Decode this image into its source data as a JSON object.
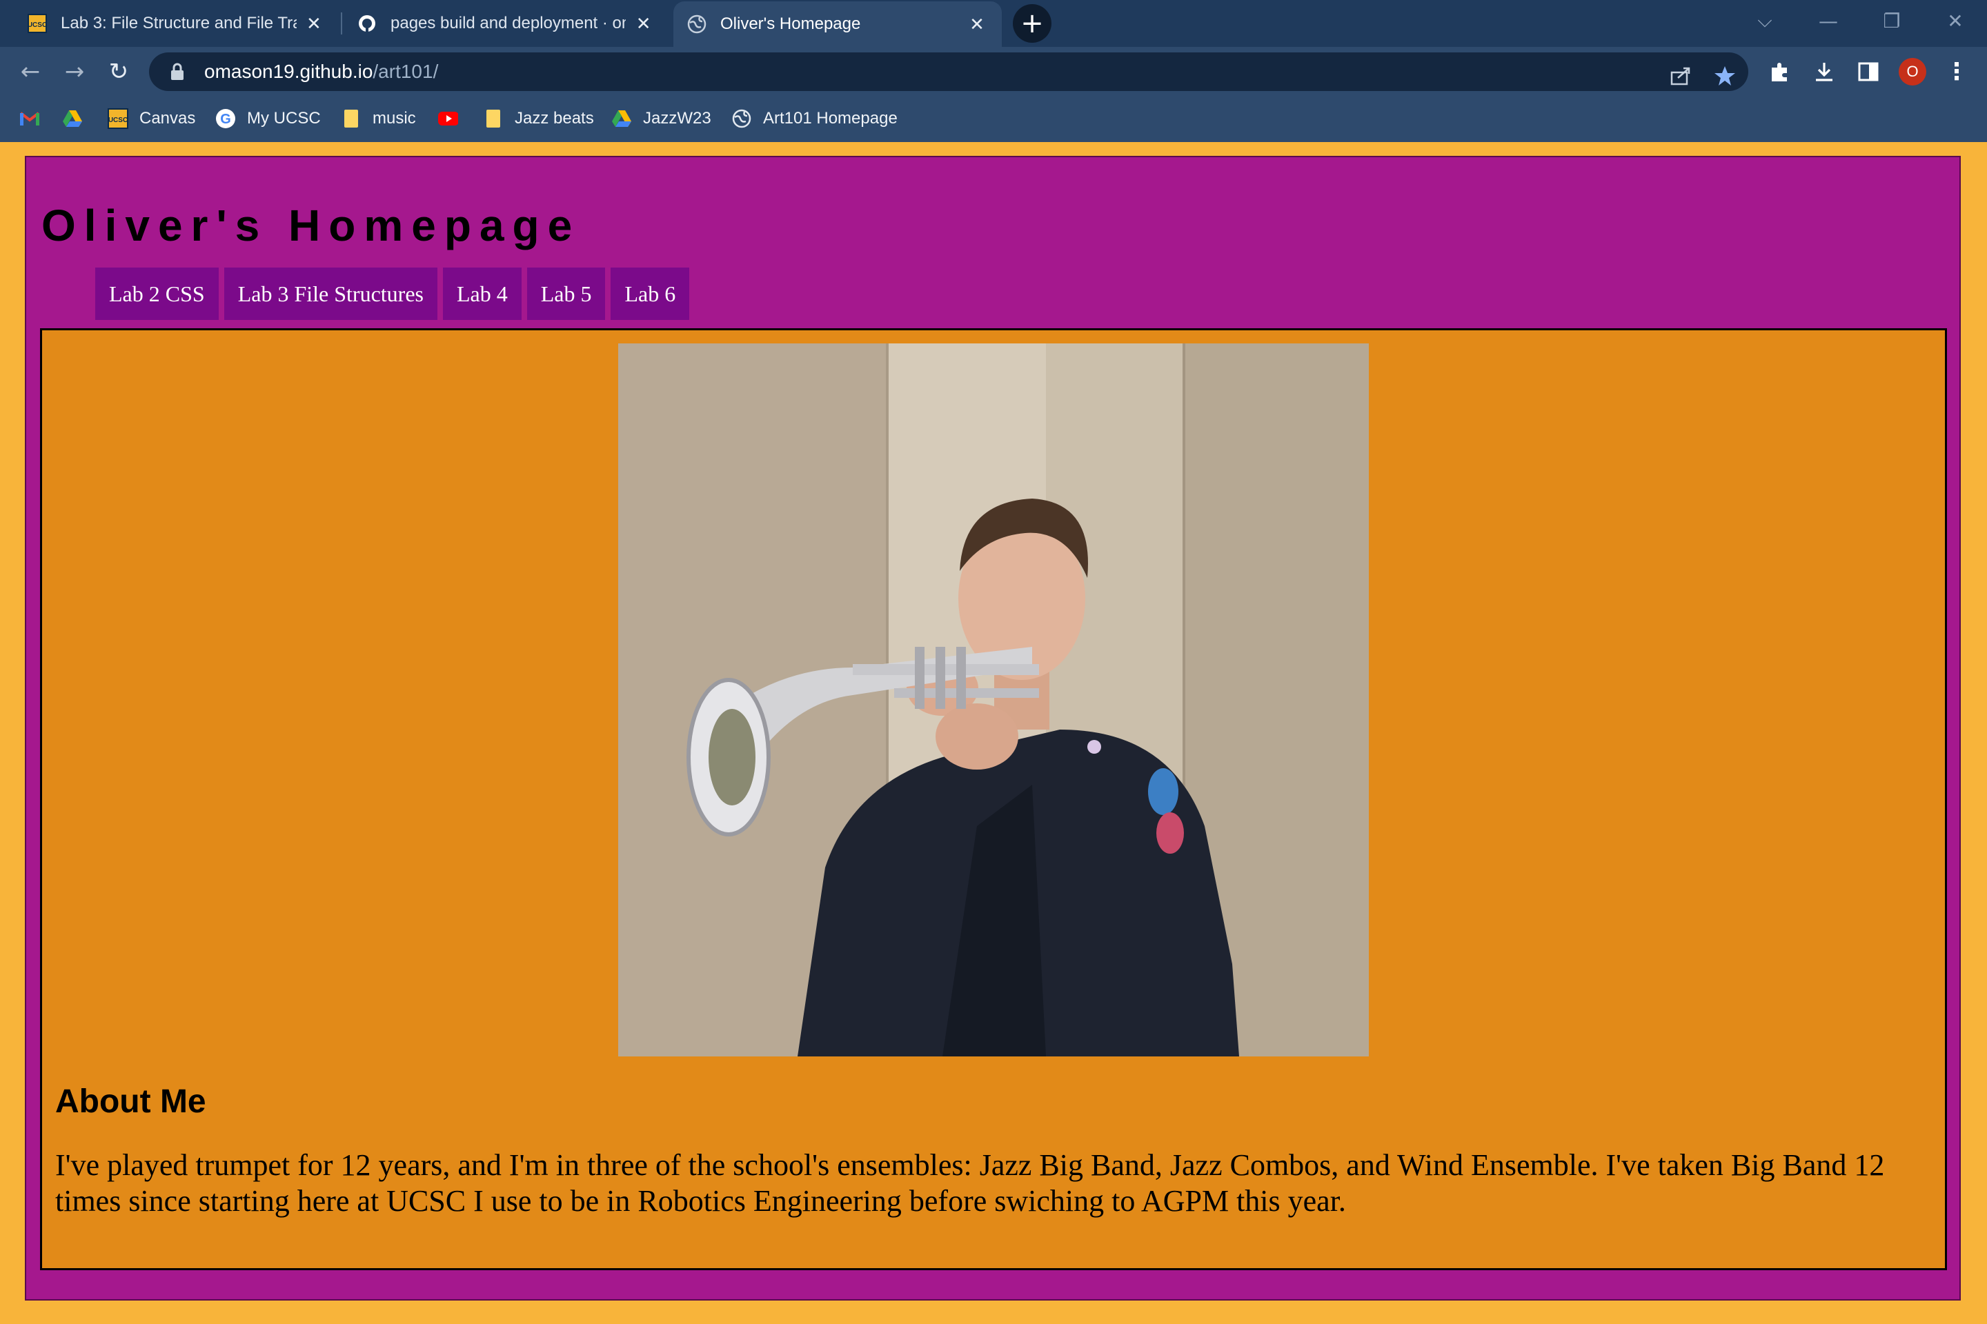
{
  "browser": {
    "tabs": [
      {
        "title": "Lab 3: File Structure and File Tran",
        "favicon": "ucsc-icon",
        "active": false
      },
      {
        "title": "pages build and deployment · om",
        "favicon": "github-icon",
        "active": false
      },
      {
        "title": "Oliver's Homepage",
        "favicon": "globe-icon",
        "active": true
      }
    ],
    "new_tab_label": "+",
    "url_host": "omason19.github.io",
    "url_path": "/art101/",
    "profile_initial": "O",
    "bookmarks": [
      {
        "label": "",
        "icon": "gmail-icon"
      },
      {
        "label": "",
        "icon": "drive-icon"
      },
      {
        "label": "Canvas",
        "icon": "ucsc-icon"
      },
      {
        "label": "My UCSC",
        "icon": "google-icon"
      },
      {
        "label": "music",
        "icon": "folder-icon"
      },
      {
        "label": "",
        "icon": "youtube-icon"
      },
      {
        "label": "Jazz beats",
        "icon": "folder-icon"
      },
      {
        "label": "JazzW23",
        "icon": "drive-icon"
      },
      {
        "label": "Art101 Homepage",
        "icon": "globe-icon"
      }
    ],
    "colors": {
      "chrome": "#2e4a6d",
      "tabstrip": "#1f3a5c",
      "omnibox": "#142740"
    }
  },
  "site": {
    "title": "Oliver's Homepage",
    "nav": [
      "Lab 2 CSS",
      "Lab 3 File Structures",
      "Lab 4",
      "Lab 5",
      "Lab 6"
    ],
    "photo_icon": "trumpet-player-photo",
    "about_heading": "About Me",
    "about_text": "I've played trumpet for 12 years, and I'm in three of the school's ensembles: Jazz Big Band, Jazz Combos, and Wind Ensemble. I've taken Big Band 12 times since starting here at UCSC I use to be in Robotics Engineering before swiching to AGPM this year.",
    "colors": {
      "page_bg": "#f8b43a",
      "outer": "#a5188e",
      "nav_bg": "#7b0a8a",
      "content": "#e28a18"
    }
  }
}
